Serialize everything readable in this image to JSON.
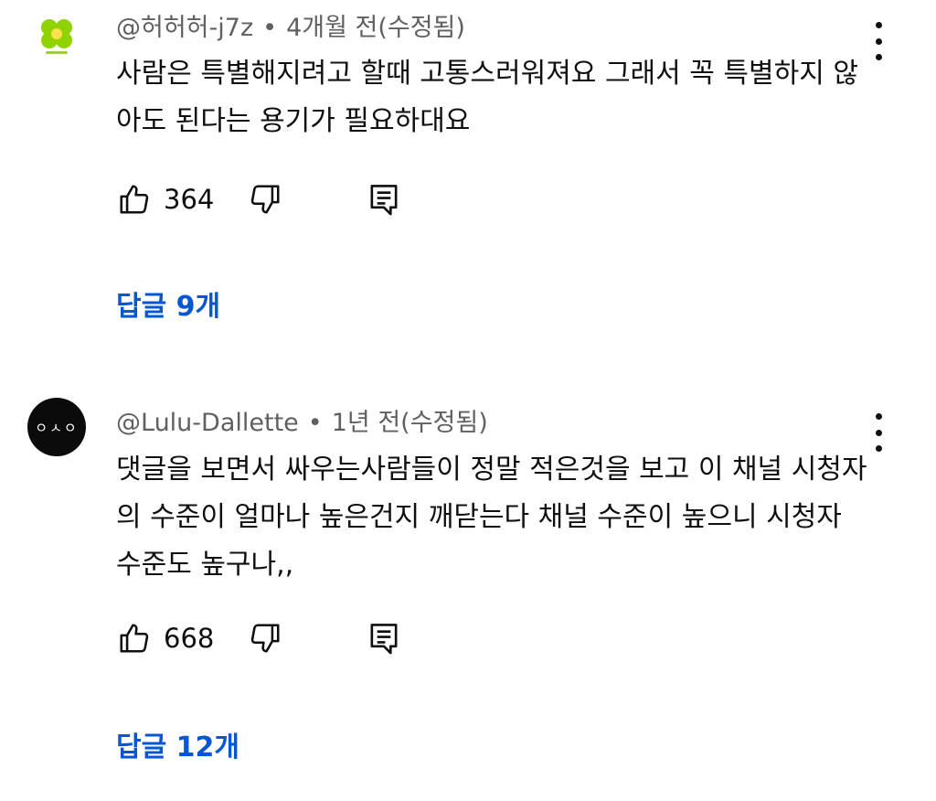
{
  "comments": [
    {
      "avatar_icon": "clover-icon",
      "author": "@허허허-j7z",
      "separator": "•",
      "time": "4개월 전(수정됨)",
      "text": "사람은 특별해지려고 할때 고통스러워져요 그래서 꼭 특별하지 않아도 된다는 용기가 필요하대요",
      "likes": "364",
      "replies_label": "답글 9개"
    },
    {
      "avatar_icon": "o-ho-avatar",
      "avatar_text": "ㅇㅅㅇ",
      "author": "@Lulu-Dallette",
      "separator": "•",
      "time": "1년 전(수정됨)",
      "text": "댓글을 보면서 싸우는사람들이 정말 적은것을 보고 이 채널 시청자의 수준이 얼마나 높은건지 깨닫는다 채널 수준이 높으니 시청자 수준도 높구나,,",
      "likes": "668",
      "replies_label": "답글 12개"
    }
  ],
  "colors": {
    "link": "#0656d6",
    "meta": "#606060",
    "text": "#0f0f0f"
  }
}
